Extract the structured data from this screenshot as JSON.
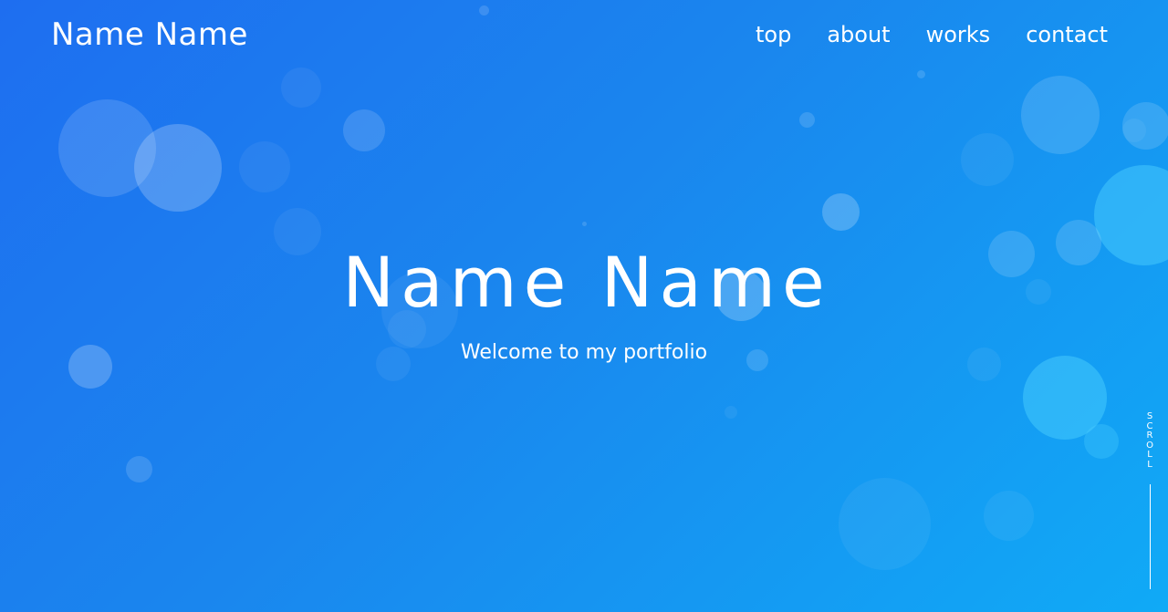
{
  "header": {
    "logo": "Name Name",
    "nav": [
      {
        "label": "top"
      },
      {
        "label": "about"
      },
      {
        "label": "works"
      },
      {
        "label": "contact"
      }
    ]
  },
  "hero": {
    "title": "Name Name",
    "subtitle": "Welcome to my portfolio"
  },
  "scroll": {
    "label": "SCROLL"
  },
  "colors": {
    "gradient_start": "#1e6ef0",
    "gradient_mid": "#1a86ee",
    "gradient_end": "#10aaf6",
    "text": "#ffffff",
    "bubble": "rgba(255,255,255,0.14)",
    "bubble_cyan": "rgba(80,210,255,0.45)"
  }
}
